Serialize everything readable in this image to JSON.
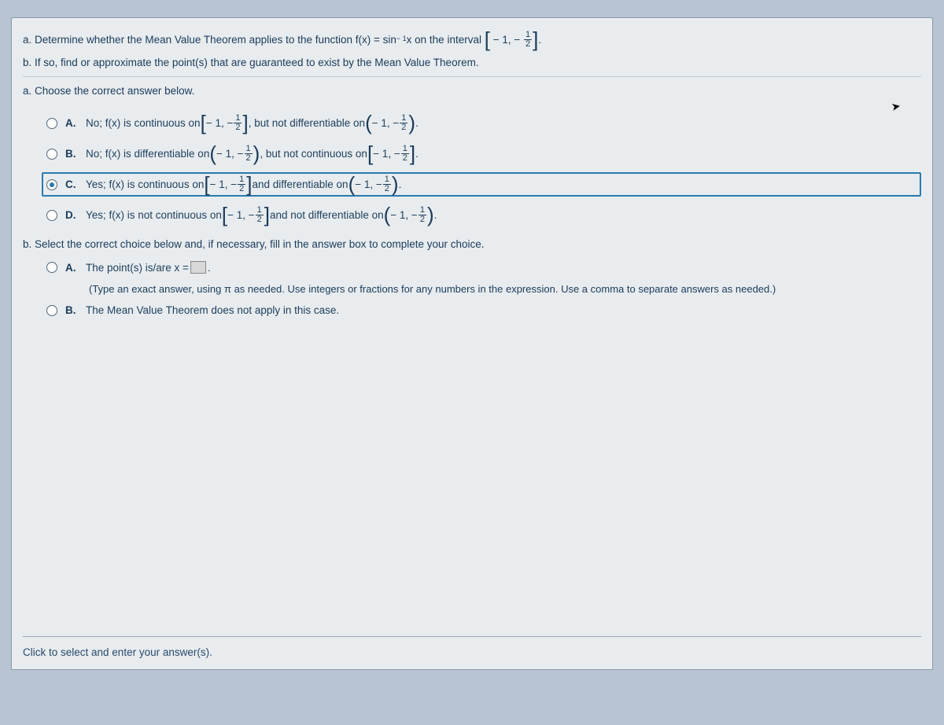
{
  "problem": {
    "a_prefix": "a. Determine whether the Mean Value Theorem applies to the function f(x) = sin",
    "a_exp": " − 1",
    "a_mid": "x on the interval ",
    "interval_open": "[",
    "interval_left": " − 1, − ",
    "frac_num": "1",
    "frac_den": "2",
    "interval_close": "]",
    "period": ".",
    "b": "b. If so, find or approximate the point(s) that are guaranteed to exist by the Mean Value Theorem."
  },
  "partA": {
    "prompt": "a. Choose the correct answer below.",
    "options": {
      "A": {
        "label": "A.",
        "t1": "No; f(x) is continuous on ",
        "t2": ", but not differentiable on "
      },
      "B": {
        "label": "B.",
        "t1": "No; f(x) is differentiable on ",
        "t2": ", but not continuous on "
      },
      "C": {
        "label": "C.",
        "t1": "Yes; f(x) is continuous on ",
        "t2": " and differentiable on "
      },
      "D": {
        "label": "D.",
        "t1": "Yes; f(x) is not continuous on ",
        "t2": " and not differentiable on "
      }
    }
  },
  "partB": {
    "prompt": "b. Select the correct choice below and, if necessary, fill in the answer box to complete your choice.",
    "A": {
      "label": "A.",
      "t1": "The point(s) is/are x = ",
      "hint": "(Type an exact answer, using π as needed. Use integers or fractions for any numbers in the expression. Use a comma to separate answers as needed.)"
    },
    "B": {
      "label": "B.",
      "t1": "The Mean Value Theorem does not apply in this case."
    }
  },
  "footer": "Click to select and enter your answer(s).",
  "math": {
    "neg1neg": " − 1, − ",
    "dot": "."
  }
}
